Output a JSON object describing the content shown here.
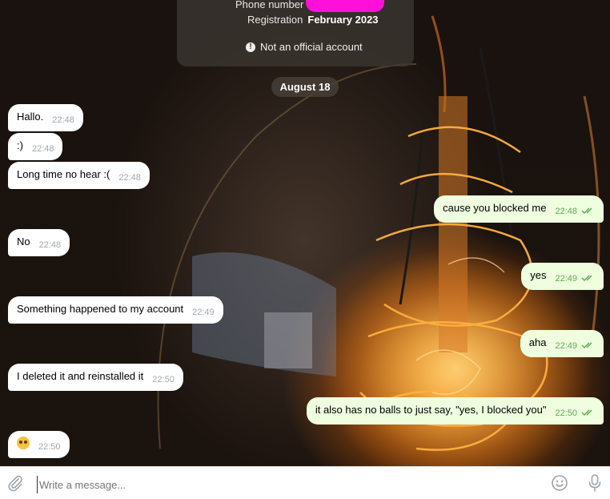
{
  "info_card": {
    "phone_label": "Phone number",
    "registration_label": "Registration",
    "registration_value": "February 2023",
    "official_notice": "Not an official account"
  },
  "date_separator": "August 18",
  "messages": [
    {
      "side": "in",
      "text": "Hallo.",
      "time": "22:48"
    },
    {
      "side": "in",
      "text": ":)",
      "time": "22:48"
    },
    {
      "side": "in",
      "text": "Long time no hear :(",
      "time": "22:48"
    },
    {
      "side": "out",
      "text": "cause you blocked me",
      "time": "22:48"
    },
    {
      "side": "in",
      "text": "No",
      "time": "22:48"
    },
    {
      "side": "out",
      "text": "yes",
      "time": "22:49"
    },
    {
      "side": "in",
      "text": "Something happened to my account",
      "time": "22:49"
    },
    {
      "side": "out",
      "text": "aha",
      "time": "22:49"
    },
    {
      "side": "in",
      "text": "I deleted it and reinstalled it",
      "time": "22:50"
    },
    {
      "side": "out",
      "text": "it also has no balls to just say, \"yes, I blocked you\"",
      "time": "22:50"
    },
    {
      "side": "in",
      "text": "",
      "emoji": "flushed-face",
      "time": "22:50"
    }
  ],
  "composer": {
    "placeholder": "Write a message..."
  },
  "icons": {
    "attach": "paperclip-icon",
    "emoji": "smiley-icon",
    "voice": "microphone-icon",
    "read": "double-check-icon",
    "notice": "exclamation-circle-icon"
  },
  "colors": {
    "incoming_bubble": "#ffffff",
    "outgoing_bubble": "#eefedf",
    "outgoing_time": "#5fae4d",
    "redaction": "#ff10d8"
  }
}
